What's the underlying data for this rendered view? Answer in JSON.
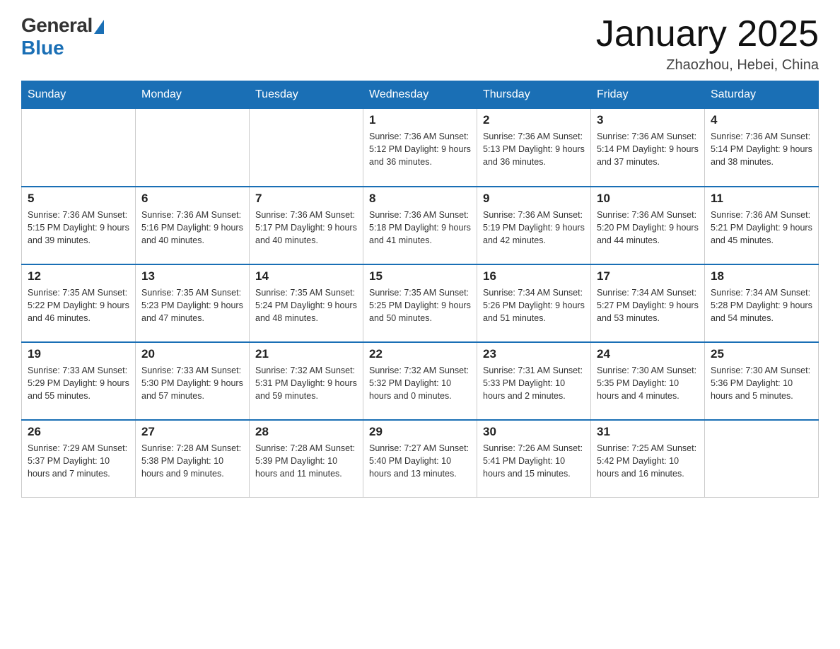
{
  "header": {
    "logo_general": "General",
    "logo_blue": "Blue",
    "title": "January 2025",
    "location": "Zhaozhou, Hebei, China"
  },
  "days_of_week": [
    "Sunday",
    "Monday",
    "Tuesday",
    "Wednesday",
    "Thursday",
    "Friday",
    "Saturday"
  ],
  "weeks": [
    [
      {
        "day": "",
        "info": ""
      },
      {
        "day": "",
        "info": ""
      },
      {
        "day": "",
        "info": ""
      },
      {
        "day": "1",
        "info": "Sunrise: 7:36 AM\nSunset: 5:12 PM\nDaylight: 9 hours\nand 36 minutes."
      },
      {
        "day": "2",
        "info": "Sunrise: 7:36 AM\nSunset: 5:13 PM\nDaylight: 9 hours\nand 36 minutes."
      },
      {
        "day": "3",
        "info": "Sunrise: 7:36 AM\nSunset: 5:14 PM\nDaylight: 9 hours\nand 37 minutes."
      },
      {
        "day": "4",
        "info": "Sunrise: 7:36 AM\nSunset: 5:14 PM\nDaylight: 9 hours\nand 38 minutes."
      }
    ],
    [
      {
        "day": "5",
        "info": "Sunrise: 7:36 AM\nSunset: 5:15 PM\nDaylight: 9 hours\nand 39 minutes."
      },
      {
        "day": "6",
        "info": "Sunrise: 7:36 AM\nSunset: 5:16 PM\nDaylight: 9 hours\nand 40 minutes."
      },
      {
        "day": "7",
        "info": "Sunrise: 7:36 AM\nSunset: 5:17 PM\nDaylight: 9 hours\nand 40 minutes."
      },
      {
        "day": "8",
        "info": "Sunrise: 7:36 AM\nSunset: 5:18 PM\nDaylight: 9 hours\nand 41 minutes."
      },
      {
        "day": "9",
        "info": "Sunrise: 7:36 AM\nSunset: 5:19 PM\nDaylight: 9 hours\nand 42 minutes."
      },
      {
        "day": "10",
        "info": "Sunrise: 7:36 AM\nSunset: 5:20 PM\nDaylight: 9 hours\nand 44 minutes."
      },
      {
        "day": "11",
        "info": "Sunrise: 7:36 AM\nSunset: 5:21 PM\nDaylight: 9 hours\nand 45 minutes."
      }
    ],
    [
      {
        "day": "12",
        "info": "Sunrise: 7:35 AM\nSunset: 5:22 PM\nDaylight: 9 hours\nand 46 minutes."
      },
      {
        "day": "13",
        "info": "Sunrise: 7:35 AM\nSunset: 5:23 PM\nDaylight: 9 hours\nand 47 minutes."
      },
      {
        "day": "14",
        "info": "Sunrise: 7:35 AM\nSunset: 5:24 PM\nDaylight: 9 hours\nand 48 minutes."
      },
      {
        "day": "15",
        "info": "Sunrise: 7:35 AM\nSunset: 5:25 PM\nDaylight: 9 hours\nand 50 minutes."
      },
      {
        "day": "16",
        "info": "Sunrise: 7:34 AM\nSunset: 5:26 PM\nDaylight: 9 hours\nand 51 minutes."
      },
      {
        "day": "17",
        "info": "Sunrise: 7:34 AM\nSunset: 5:27 PM\nDaylight: 9 hours\nand 53 minutes."
      },
      {
        "day": "18",
        "info": "Sunrise: 7:34 AM\nSunset: 5:28 PM\nDaylight: 9 hours\nand 54 minutes."
      }
    ],
    [
      {
        "day": "19",
        "info": "Sunrise: 7:33 AM\nSunset: 5:29 PM\nDaylight: 9 hours\nand 55 minutes."
      },
      {
        "day": "20",
        "info": "Sunrise: 7:33 AM\nSunset: 5:30 PM\nDaylight: 9 hours\nand 57 minutes."
      },
      {
        "day": "21",
        "info": "Sunrise: 7:32 AM\nSunset: 5:31 PM\nDaylight: 9 hours\nand 59 minutes."
      },
      {
        "day": "22",
        "info": "Sunrise: 7:32 AM\nSunset: 5:32 PM\nDaylight: 10 hours\nand 0 minutes."
      },
      {
        "day": "23",
        "info": "Sunrise: 7:31 AM\nSunset: 5:33 PM\nDaylight: 10 hours\nand 2 minutes."
      },
      {
        "day": "24",
        "info": "Sunrise: 7:30 AM\nSunset: 5:35 PM\nDaylight: 10 hours\nand 4 minutes."
      },
      {
        "day": "25",
        "info": "Sunrise: 7:30 AM\nSunset: 5:36 PM\nDaylight: 10 hours\nand 5 minutes."
      }
    ],
    [
      {
        "day": "26",
        "info": "Sunrise: 7:29 AM\nSunset: 5:37 PM\nDaylight: 10 hours\nand 7 minutes."
      },
      {
        "day": "27",
        "info": "Sunrise: 7:28 AM\nSunset: 5:38 PM\nDaylight: 10 hours\nand 9 minutes."
      },
      {
        "day": "28",
        "info": "Sunrise: 7:28 AM\nSunset: 5:39 PM\nDaylight: 10 hours\nand 11 minutes."
      },
      {
        "day": "29",
        "info": "Sunrise: 7:27 AM\nSunset: 5:40 PM\nDaylight: 10 hours\nand 13 minutes."
      },
      {
        "day": "30",
        "info": "Sunrise: 7:26 AM\nSunset: 5:41 PM\nDaylight: 10 hours\nand 15 minutes."
      },
      {
        "day": "31",
        "info": "Sunrise: 7:25 AM\nSunset: 5:42 PM\nDaylight: 10 hours\nand 16 minutes."
      },
      {
        "day": "",
        "info": ""
      }
    ]
  ]
}
